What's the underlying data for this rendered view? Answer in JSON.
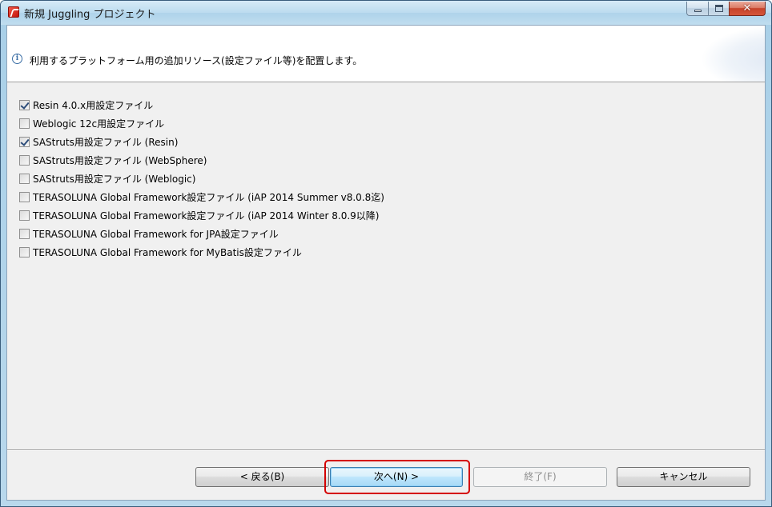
{
  "window": {
    "title": "新規 Juggling プロジェクト",
    "close_glyph": "✕"
  },
  "banner": {
    "info_glyph": "i",
    "message": "利用するプラットフォーム用の追加リソース(設定ファイル等)を配置します。"
  },
  "options": [
    {
      "label": "Resin 4.0.x用設定ファイル",
      "checked": true
    },
    {
      "label": "Weblogic 12c用設定ファイル",
      "checked": false
    },
    {
      "label": "SAStruts用設定ファイル (Resin)",
      "checked": true
    },
    {
      "label": "SAStruts用設定ファイル (WebSphere)",
      "checked": false
    },
    {
      "label": "SAStruts用設定ファイル (Weblogic)",
      "checked": false
    },
    {
      "label": "TERASOLUNA Global Framework設定ファイル (iAP 2014 Summer v8.0.8迄)",
      "checked": false
    },
    {
      "label": "TERASOLUNA Global Framework設定ファイル (iAP 2014 Winter 8.0.9以降)",
      "checked": false
    },
    {
      "label": "TERASOLUNA Global Framework for JPA設定ファイル",
      "checked": false
    },
    {
      "label": "TERASOLUNA Global Framework for MyBatis設定ファイル",
      "checked": false
    }
  ],
  "buttons": {
    "back": "< 戻る(B)",
    "next": "次へ(N) >",
    "finish": "終了(F)",
    "cancel": "キャンセル"
  },
  "colors": {
    "highlight": "#d40000",
    "accent": "#3c7fb1"
  },
  "icons": {
    "app": "juggling-app-icon",
    "info": "info-icon",
    "minimize": "minimize-icon",
    "maximize": "maximize-icon",
    "close": "close-icon"
  }
}
